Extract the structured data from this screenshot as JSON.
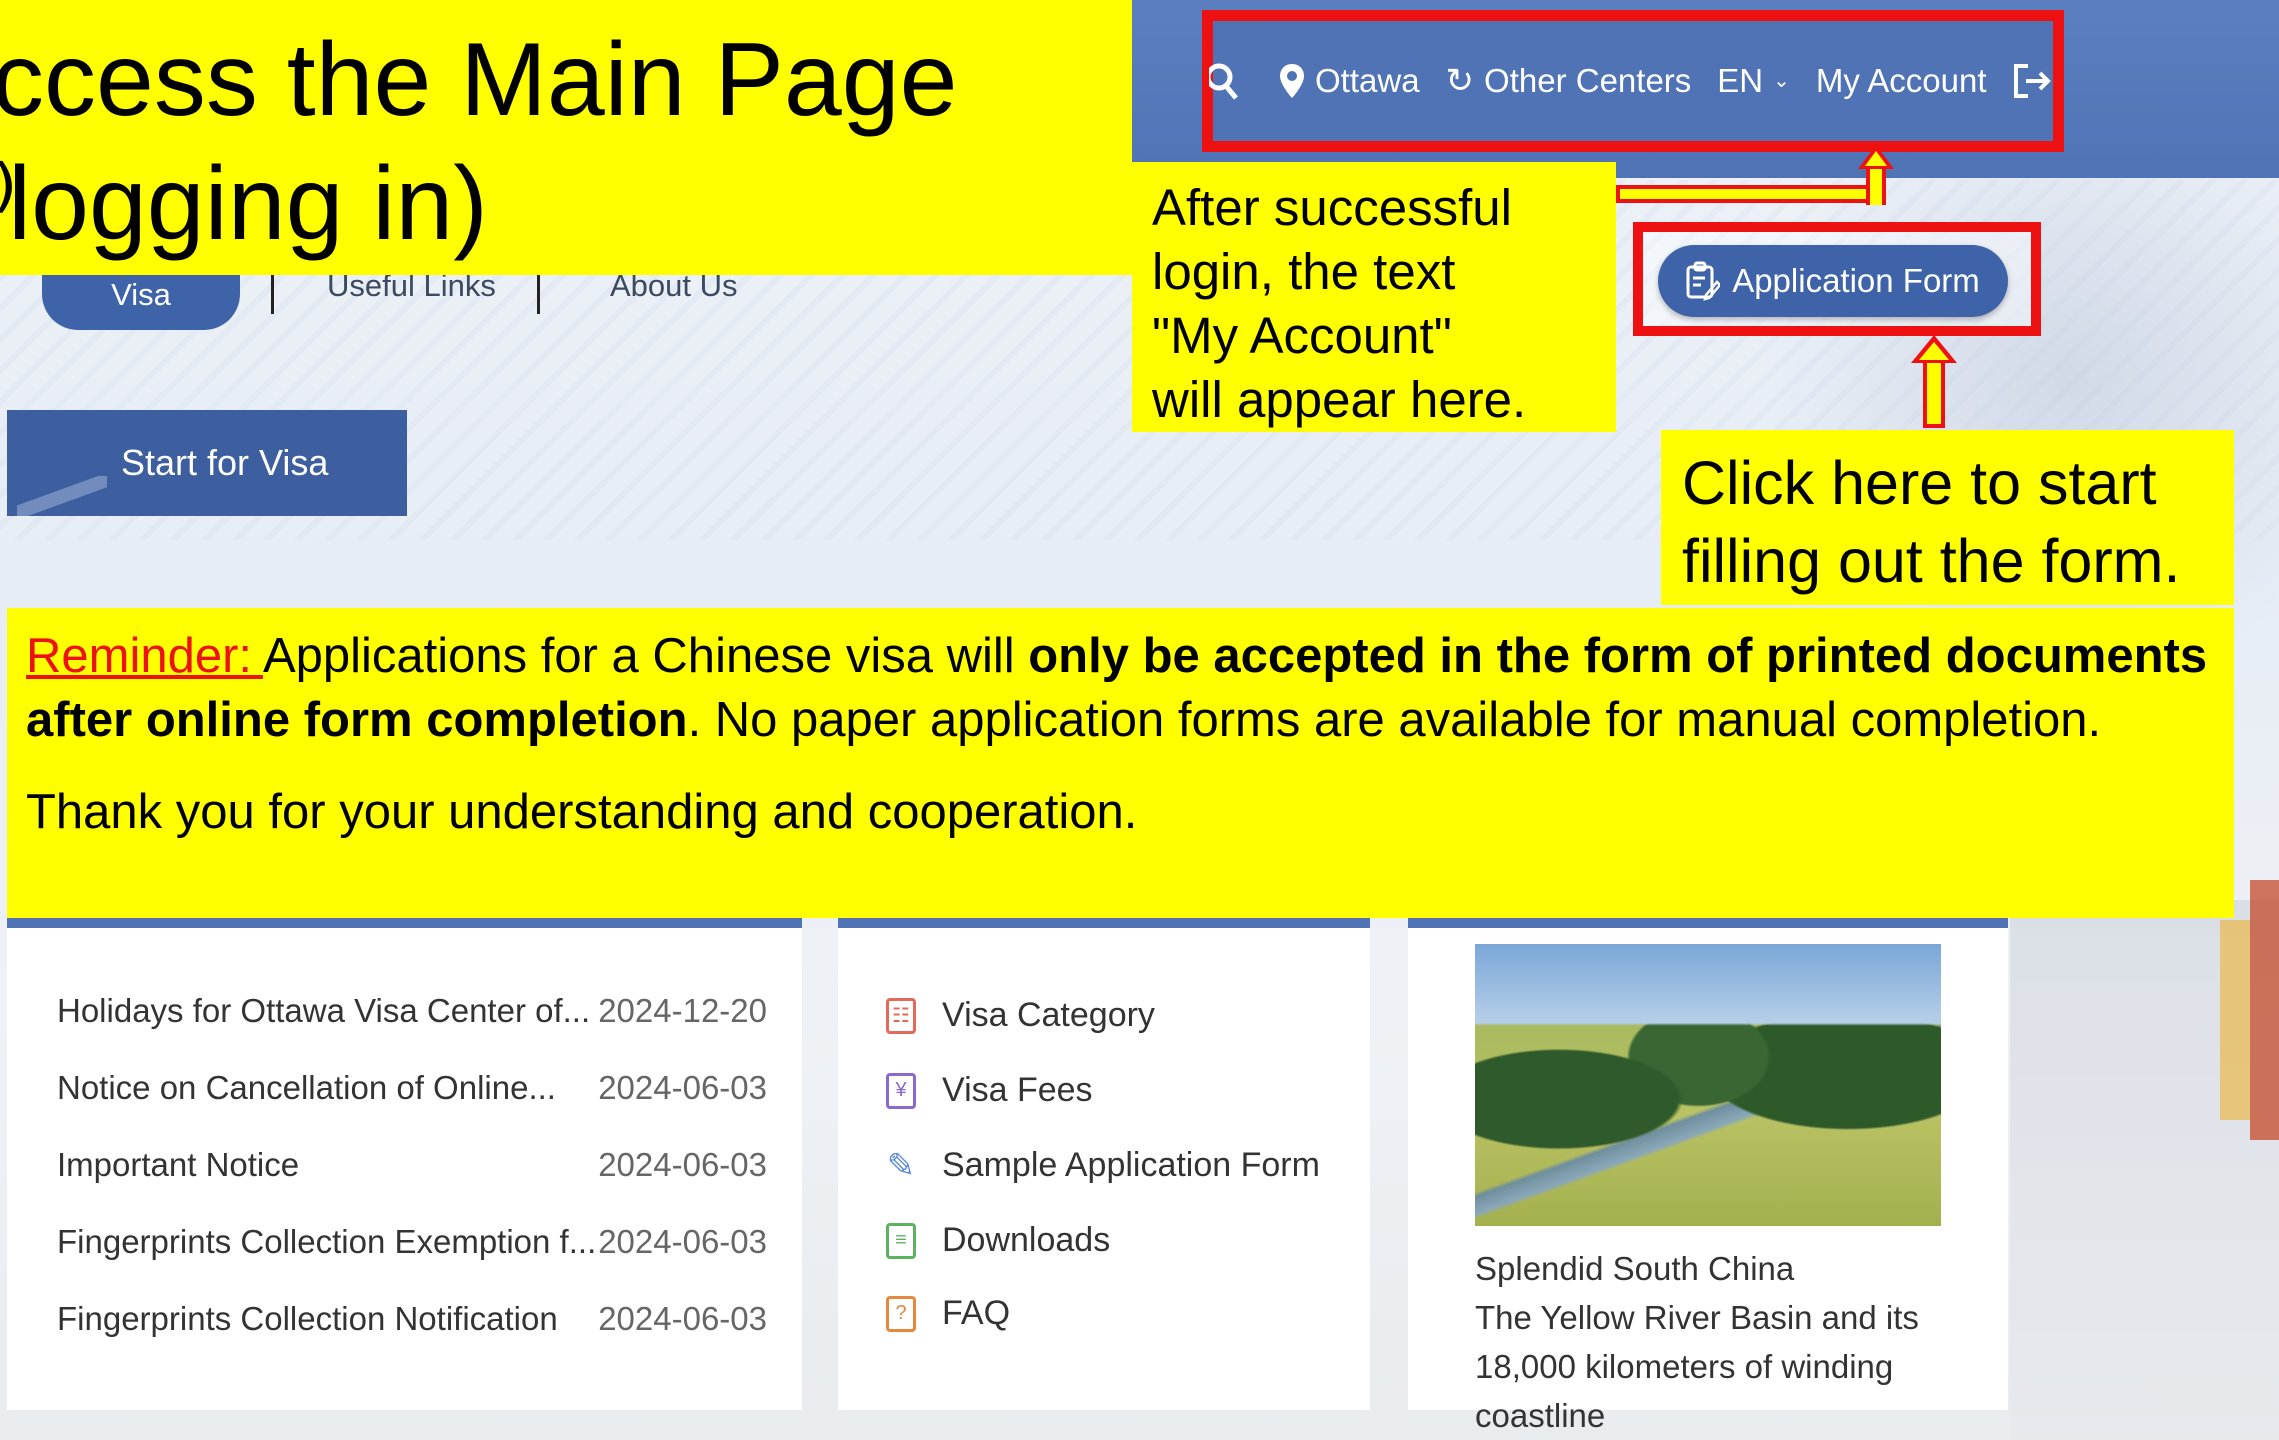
{
  "title": {
    "line1": "ccess the Main Page",
    "line2": "logging in)"
  },
  "header": {
    "search_icon": "search-icon",
    "location": "Ottawa",
    "other_centers": "Other Centers",
    "language": "EN",
    "my_account": "My Account",
    "logout_icon": "logout-icon"
  },
  "menu": {
    "visa": "Visa",
    "useful_links": "Useful Links",
    "about_us": "About Us"
  },
  "start_for_visa": "Start for Visa",
  "login_note": {
    "line1": "After successful",
    "line2": "login, the text",
    "line3": "\"My Account\"",
    "line4": "will appear here."
  },
  "application_form_button": "Application Form",
  "click_note": {
    "line1": "Click here to start",
    "line2": "filling out the form."
  },
  "reminder": {
    "label": "Reminder: ",
    "text1": "Applications for a Chinese visa will ",
    "bold": "only be accepted in the form of printed documents after online form completion",
    "text2": ". No paper application forms are available for manual completion.",
    "thanks": "Thank you for your understanding and cooperation."
  },
  "news": [
    {
      "title": "Holidays for Ottawa Visa Center of...",
      "date": "2024-12-20"
    },
    {
      "title": "Notice on Cancellation of Online...",
      "date": "2024-06-03"
    },
    {
      "title": "Important Notice",
      "date": "2024-06-03"
    },
    {
      "title": "Fingerprints Collection Exemption f...",
      "date": "2024-06-03"
    },
    {
      "title": "Fingerprints Collection Notification",
      "date": "2024-06-03"
    }
  ],
  "quick_links": [
    {
      "label": "Visa Category",
      "icon": "category-icon"
    },
    {
      "label": "Visa Fees",
      "icon": "yuan-icon"
    },
    {
      "label": "Sample Application Form",
      "icon": "pen-icon"
    },
    {
      "label": "Downloads",
      "icon": "document-icon"
    },
    {
      "label": "FAQ",
      "icon": "question-icon"
    }
  ],
  "photo_caption": {
    "line1": "Splendid South China",
    "line2": "The Yellow River Basin and its",
    "line3": "18,000 kilometers of winding",
    "line4": "coastline"
  },
  "colors": {
    "header_blue": "#4f73b4",
    "highlight_yellow": "#ffff00",
    "annotation_red": "#ee1111"
  }
}
